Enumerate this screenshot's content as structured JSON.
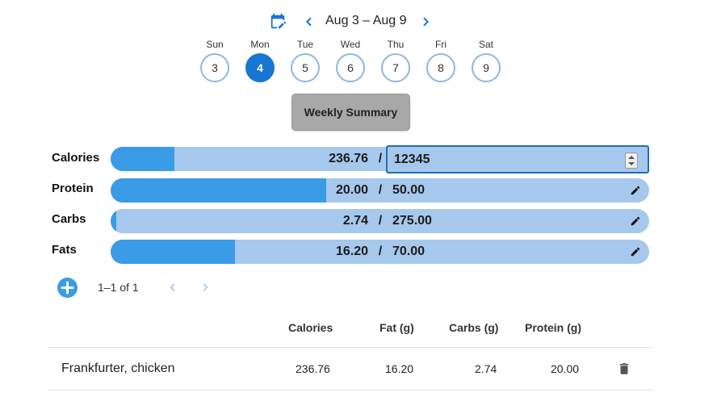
{
  "header": {
    "week_range": "Aug 3 – Aug 9",
    "icons": {
      "calendar": "calendar-edit-icon",
      "prev": "chevron-left-icon",
      "next": "chevron-right-icon"
    }
  },
  "days": [
    {
      "name": "Sun",
      "num": "3",
      "selected": false
    },
    {
      "name": "Mon",
      "num": "4",
      "selected": true
    },
    {
      "name": "Tue",
      "num": "5",
      "selected": false
    },
    {
      "name": "Wed",
      "num": "6",
      "selected": false
    },
    {
      "name": "Thu",
      "num": "7",
      "selected": false
    },
    {
      "name": "Fri",
      "num": "8",
      "selected": false
    },
    {
      "name": "Sat",
      "num": "9",
      "selected": false
    }
  ],
  "summary_button": "Weekly Summary",
  "macros": {
    "calories": {
      "label": "Calories",
      "current": "236.76",
      "separator": "/",
      "goal_input_value": "12345",
      "fill_fraction": 0.118
    },
    "protein": {
      "label": "Protein",
      "current": "20.00",
      "separator": "/",
      "goal": "50.00",
      "fill_fraction": 0.4
    },
    "carbs": {
      "label": "Carbs",
      "current": "2.74",
      "separator": "/",
      "goal": "275.00",
      "fill_fraction": 0.01
    },
    "fats": {
      "label": "Fats",
      "current": "16.20",
      "separator": "/",
      "goal": "70.00",
      "fill_fraction": 0.231
    }
  },
  "pagination": {
    "range_text": "1–1 of 1"
  },
  "table": {
    "columns": [
      "Calories",
      "Fat (g)",
      "Carbs (g)",
      "Protein (g)"
    ],
    "rows": [
      {
        "food": "Frankfurter, chicken",
        "calories": "236.76",
        "fat": "16.20",
        "carbs": "2.74",
        "protein": "20.00"
      }
    ]
  },
  "colors": {
    "accent": "#1976d2",
    "bar_fill": "#3a9be7",
    "bar_track": "#a6c8ed",
    "button_gray": "#a8a8a8"
  }
}
